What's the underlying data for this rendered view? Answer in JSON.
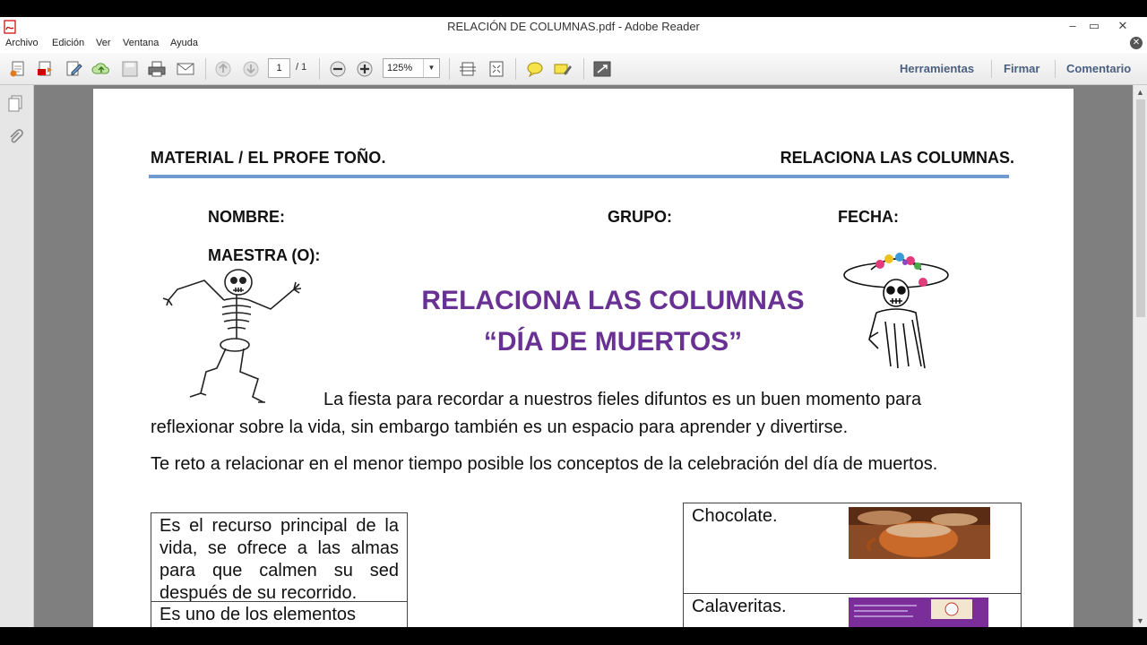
{
  "window": {
    "title": "RELACIÓN DE COLUMNAS.pdf - Adobe Reader",
    "minimize": "–",
    "restore": "▭",
    "close": "✕"
  },
  "menu": {
    "items": [
      "Archivo",
      "Edición",
      "Ver",
      "Ventana",
      "Ayuda"
    ],
    "close": "✕"
  },
  "toolbar": {
    "page_current": "1",
    "page_total": "/ 1",
    "zoom": "125%",
    "zoom_dropdown": "▼",
    "right_links": [
      "Herramientas",
      "Firmar",
      "Comentario"
    ]
  },
  "scrollbar": {
    "up": "▲",
    "down": "▼"
  },
  "document": {
    "header_left": "MATERIAL / EL PROFE TOÑO.",
    "header_right": "RELACIONA LAS COLUMNAS.",
    "labels": {
      "nombre": "NOMBRE:",
      "grupo": "GRUPO:",
      "fecha": "FECHA:",
      "maestra": "MAESTRA (O):"
    },
    "title_line1": "RELACIONA LAS COLUMNAS",
    "title_line2": "“DÍA DE MUERTOS”",
    "intro_line1": "La fiesta para recordar a nuestros fieles difuntos es un buen momento para",
    "intro_line2": "reflexionar sobre la vida, sin embargo también es un espacio para aprender y divertirse.",
    "instruction": "Te reto a relacionar en el menor tiempo posible los conceptos de la celebración del día de muertos.",
    "left_column": [
      "Es el recurso principal de la vida, se ofrece a las almas para que calmen su sed después de su recorrido.",
      "Es uno de los elementos"
    ],
    "right_column": [
      "Chocolate.",
      "Calaveritas."
    ]
  },
  "colors": {
    "title_purple": "#6a3194",
    "header_rule": "#6f9bd0",
    "toolbar_link": "#4a5f7f"
  }
}
